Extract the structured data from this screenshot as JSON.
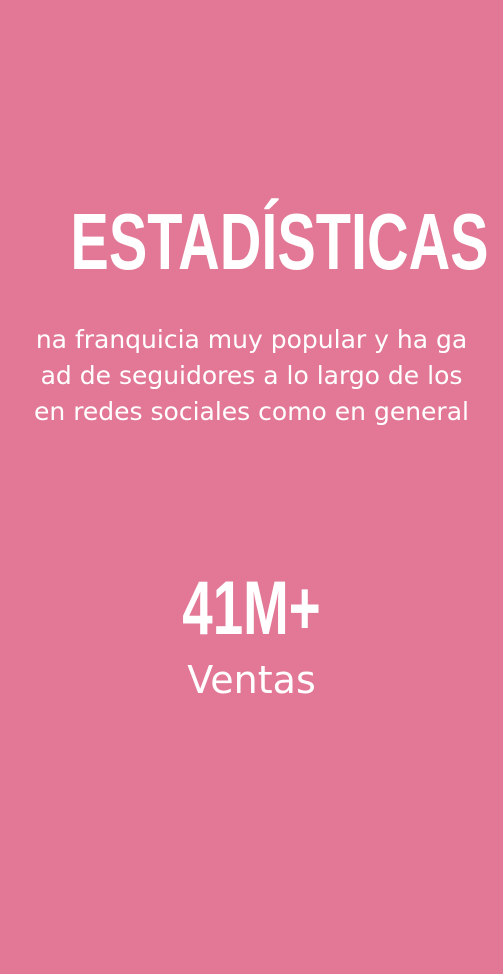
{
  "section": {
    "title": "ESTADÍSTICAS",
    "description_lines": [
      "na franquicia muy popular y ha ga",
      "ad de seguidores a lo largo de los",
      "en redes sociales como en general"
    ]
  },
  "stat": {
    "value": "41M+",
    "label": "Ventas"
  },
  "colors": {
    "background": "#e27896",
    "text": "#ffffff"
  }
}
